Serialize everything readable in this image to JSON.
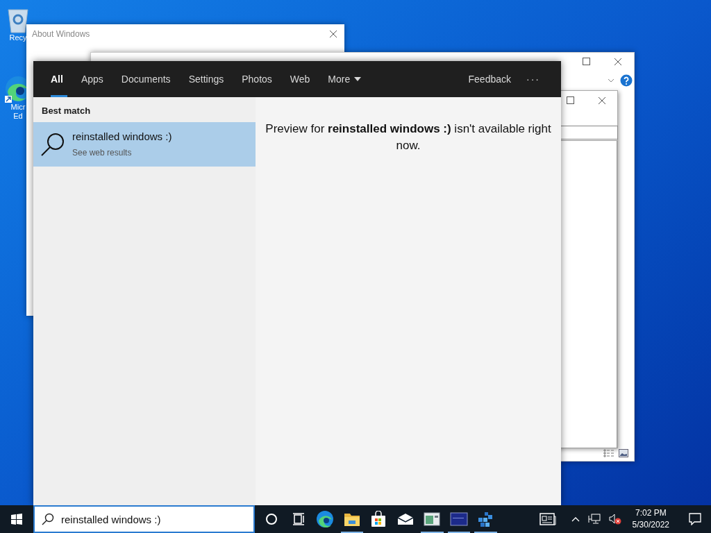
{
  "desktop_icons": [
    {
      "kind": "recycle",
      "label_lines": [
        "Recy"
      ]
    },
    {
      "kind": "edge",
      "label_lines": [
        "Micr",
        "Ed"
      ]
    }
  ],
  "about_window": {
    "title": "About Windows"
  },
  "search_panel": {
    "tabs": [
      {
        "label": "All",
        "selected": true,
        "has_menu": false
      },
      {
        "label": "Apps",
        "selected": false,
        "has_menu": false
      },
      {
        "label": "Documents",
        "selected": false,
        "has_menu": false
      },
      {
        "label": "Settings",
        "selected": false,
        "has_menu": false
      },
      {
        "label": "Photos",
        "selected": false,
        "has_menu": false
      },
      {
        "label": "Web",
        "selected": false,
        "has_menu": false
      },
      {
        "label": "More",
        "selected": false,
        "has_menu": true
      }
    ],
    "feedback": "Feedback",
    "options": "···",
    "section_title": "Best match",
    "results": [
      {
        "title": "reinstalled windows :)",
        "subtitle": "See web results",
        "selected": true
      }
    ],
    "preview": "Preview for **reinstalled windows :)** isn't available right now."
  },
  "taskbar": {
    "search_value": "reinstalled windows :)",
    "apps": [
      {
        "kind": "cortana",
        "running": false
      },
      {
        "kind": "taskview",
        "running": false
      },
      {
        "kind": "edge",
        "running": false
      },
      {
        "kind": "folder",
        "running": true
      },
      {
        "kind": "store",
        "running": false
      },
      {
        "kind": "mail",
        "running": false
      },
      {
        "kind": "window",
        "running": true
      },
      {
        "kind": "screen",
        "running": true
      },
      {
        "kind": "cubes",
        "running": true
      }
    ],
    "time": "7:02 PM",
    "date": "5/30/2022"
  }
}
